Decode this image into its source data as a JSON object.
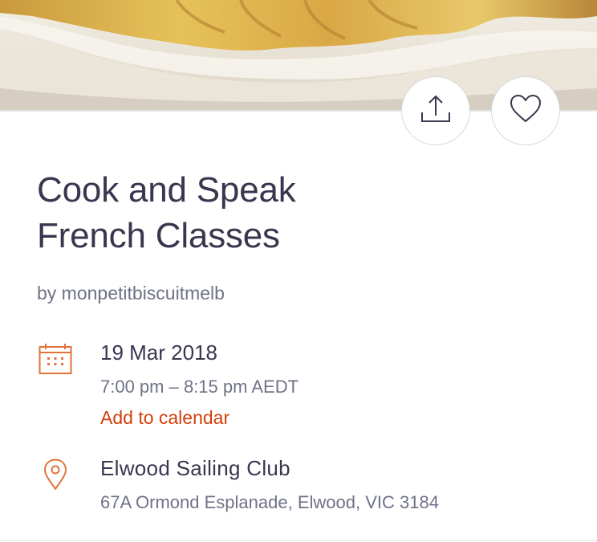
{
  "event": {
    "title_line1": "Cook and Speak",
    "title_line2": "French Classes",
    "organizer": "by monpetitbiscuitmelb"
  },
  "actions": {
    "share_icon": "share-icon",
    "save_icon": "heart-icon"
  },
  "datetime": {
    "icon": "calendar-icon",
    "date": "19 Mar 2018",
    "time": "7:00 pm – 8:15 pm AEDT",
    "add_to_calendar": "Add to calendar"
  },
  "location": {
    "icon": "location-pin-icon",
    "venue": "Elwood Sailing Club",
    "address": "67A Ormond Esplanade, Elwood, VIC 3184"
  },
  "colors": {
    "accent": "#d1410c",
    "icon_orange": "#e0733b",
    "title_text": "#39364f",
    "secondary_text": "#6f7287"
  }
}
